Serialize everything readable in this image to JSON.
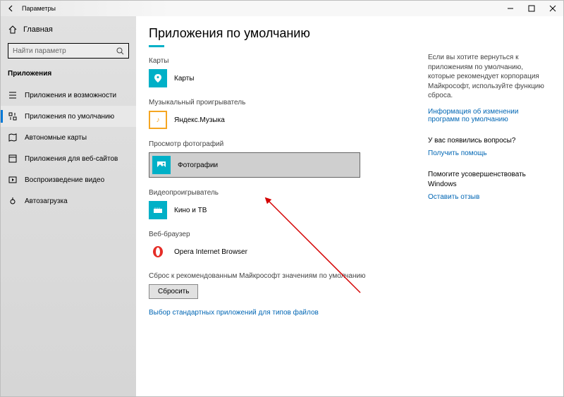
{
  "window": {
    "title": "Параметры"
  },
  "sidebar": {
    "home": "Главная",
    "search_placeholder": "Найти параметр",
    "group": "Приложения",
    "items": [
      {
        "label": "Приложения и возможности"
      },
      {
        "label": "Приложения по умолчанию"
      },
      {
        "label": "Автономные карты"
      },
      {
        "label": "Приложения для веб-сайтов"
      },
      {
        "label": "Воспроизведение видео"
      },
      {
        "label": "Автозагрузка"
      }
    ]
  },
  "main": {
    "title": "Приложения по умолчанию",
    "sections": [
      {
        "label": "Карты",
        "app": "Карты"
      },
      {
        "label": "Музыкальный проигрыватель",
        "app": "Яндекс.Музыка"
      },
      {
        "label": "Просмотр фотографий",
        "app": "Фотографии"
      },
      {
        "label": "Видеопроигрыватель",
        "app": "Кино и ТВ"
      },
      {
        "label": "Веб-браузер",
        "app": "Opera Internet Browser"
      }
    ],
    "reset_label": "Сброс к рекомендованным Майкрософт значениям по умолчанию",
    "reset_btn": "Сбросить",
    "link": "Выбор стандартных приложений для типов файлов"
  },
  "aside": {
    "info": "Если вы хотите вернуться к приложениям по умолчанию, которые рекомендует корпорация Майкрософт, используйте функцию сброса.",
    "link1": "Информация об изменении программ по умолчанию",
    "q1": "У вас появились вопросы?",
    "link2": "Получить помощь",
    "q2": "Помогите усовершенствовать Windows",
    "link3": "Оставить отзыв"
  }
}
